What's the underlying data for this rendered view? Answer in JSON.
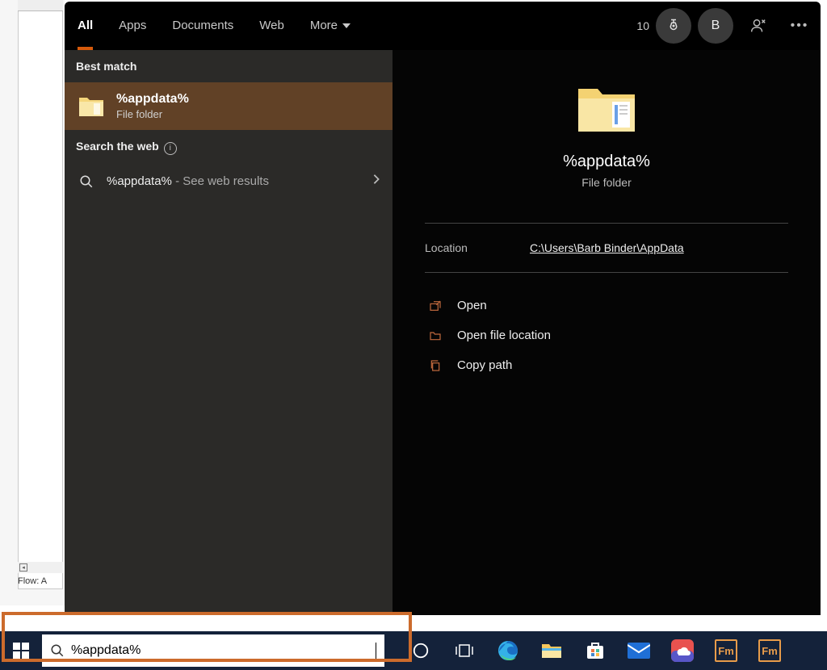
{
  "tabs": {
    "all": "All",
    "apps": "Apps",
    "documents": "Documents",
    "web": "Web",
    "more": "More"
  },
  "header": {
    "points": "10",
    "user_initial": "B"
  },
  "left": {
    "best_match": "Best match",
    "result_name": "%appdata%",
    "result_type": "File folder",
    "search_web": "Search the web",
    "web_query": "%appdata%",
    "web_suffix": " - See web results"
  },
  "detail": {
    "title": "%appdata%",
    "type": "File folder",
    "location_label": "Location",
    "location_value": "C:\\Users\\Barb Binder\\AppData",
    "open": "Open",
    "open_loc": "Open file location",
    "copy_path": "Copy path"
  },
  "taskbar": {
    "search_value": "%appdata%"
  },
  "bg": {
    "flow": "Flow: A"
  }
}
